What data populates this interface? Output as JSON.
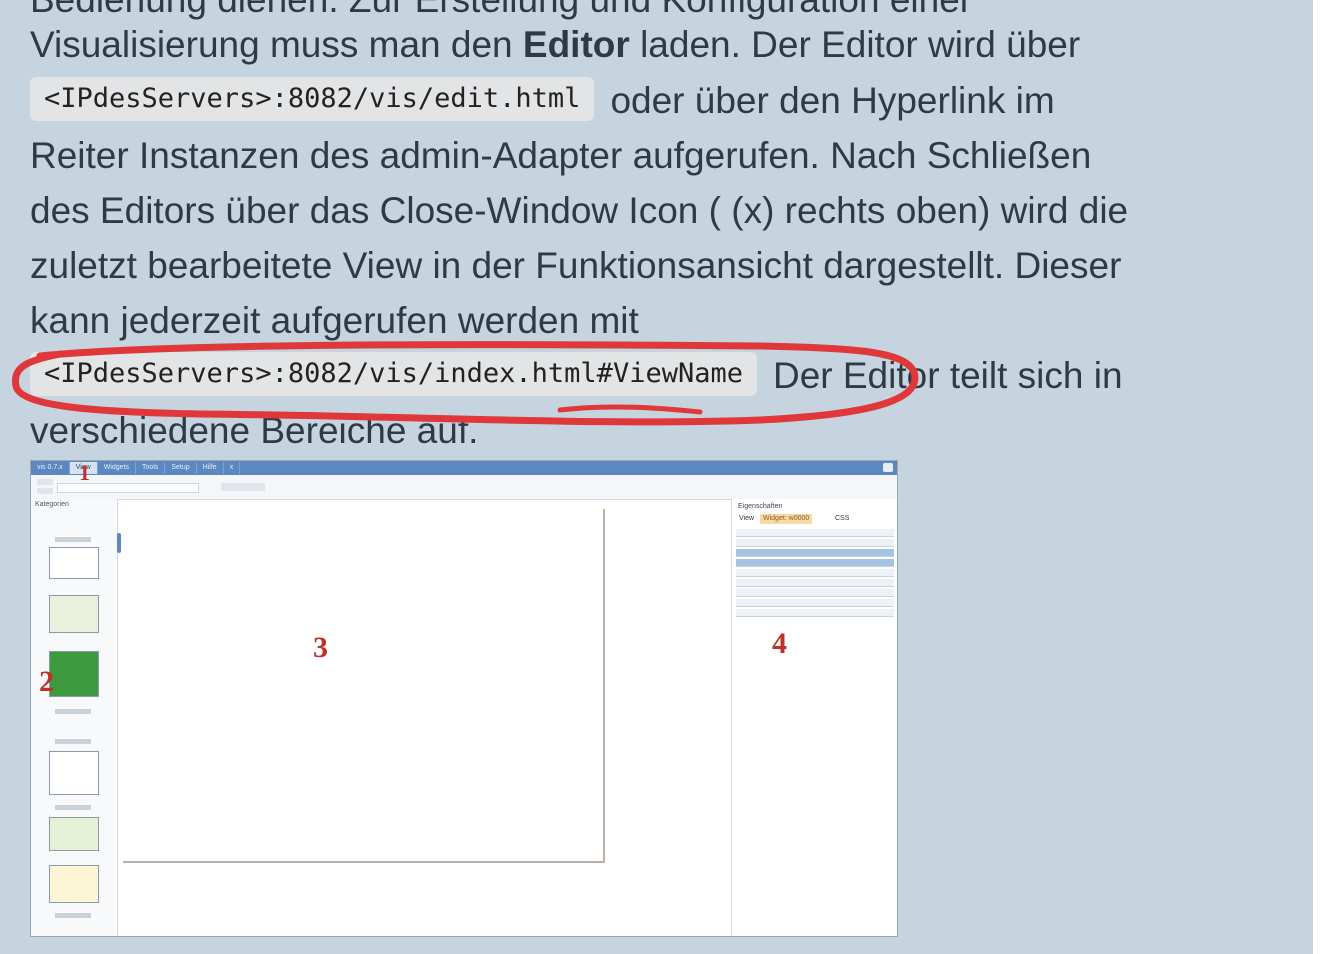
{
  "article": {
    "line0": "Bedienung dienen. Zur Erstellung und Konfiguration einer",
    "line1_pre": "Visualisierung muss man den ",
    "line1_bold": "Editor",
    "line1_post": " laden. Der Editor wird über",
    "code_edit": "<IPdesServers>:8082/vis/edit.html",
    "line2_post": "oder über den Hyperlink im",
    "line3": "Reiter Instanzen des admin-Adapter aufgerufen. Nach Schließen",
    "line4": "des Editors über das Close-Window Icon ( (x) rechts oben) wird die",
    "line5": "zuletzt bearbeitete View in der Funktionsansicht dargestellt. Dieser",
    "line6": "kann jederzeit aufgerufen werden mit",
    "code_index": "<IPdesServers>:8082/vis/index.html#ViewName",
    "line7_post": "Der Editor teilt sich in",
    "line8": "verschiedene Bereiche auf."
  },
  "screenshot": {
    "menu_tabs": [
      "vis 0.7.x",
      "View",
      "Widgets",
      "Tools",
      "Setup",
      "Hilfe",
      "x"
    ],
    "sidebar_title": "Kategorien",
    "panel_title": "Eigenschaften",
    "panel_tabs": [
      "View",
      "Widget: w0000",
      "CSS"
    ],
    "region_labels": [
      "1",
      "2",
      "3",
      "4"
    ]
  },
  "colors": {
    "page_background": "#c6d4df",
    "text": "#2f3a46",
    "code_background": "#e2e4e6",
    "annotation_red": "#e0373a",
    "label_red": "#c0302b",
    "menubar_blue": "#5b88c0"
  },
  "icons": [
    "close-window-icon"
  ]
}
